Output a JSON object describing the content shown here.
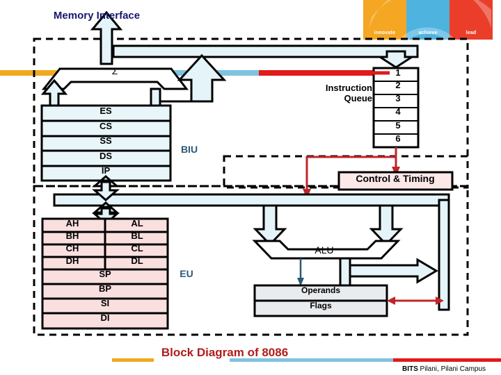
{
  "slide": {
    "memory_interface_label": "Memory Interface",
    "adder_symbol": "Σ",
    "biu_label": "BIU",
    "eu_label": "EU",
    "alu_label": "ALU",
    "instruction_queue_label_line1": "Instruction",
    "instruction_queue_label_line2": "Queue",
    "control_timing_label": "Control & Timing",
    "operands_label": "Operands",
    "flags_label": "Flags",
    "title": "Block Diagram of 8086"
  },
  "segment_registers": [
    {
      "name": "ES"
    },
    {
      "name": "CS"
    },
    {
      "name": "SS"
    },
    {
      "name": "DS"
    },
    {
      "name": "IP"
    }
  ],
  "instruction_queue_slots": [
    "1",
    "2",
    "3",
    "4",
    "5",
    "6"
  ],
  "general_registers": {
    "split_rows": [
      {
        "high": "AH",
        "low": "AL"
      },
      {
        "high": "BH",
        "low": "BL"
      },
      {
        "high": "CH",
        "low": "CL"
      },
      {
        "high": "DH",
        "low": "DL"
      }
    ],
    "full_rows": [
      {
        "name": "SP"
      },
      {
        "name": "BP"
      },
      {
        "name": "SI"
      },
      {
        "name": "DI"
      }
    ]
  },
  "logo": {
    "segments": [
      {
        "text": "innovate",
        "color": "#f5a623"
      },
      {
        "text": "achieve",
        "color": "#4fb3e0"
      },
      {
        "text": "lead",
        "color": "#ea3e2a"
      }
    ]
  },
  "footer": {
    "brand_bold": "BITS",
    "brand_rest": " Pilani, Pilani Campus"
  },
  "colors": {
    "bus_fill": "#e4f4f8",
    "segment_fill": "#e8f6fa",
    "register_fill": "#fadfdf",
    "control_fill": "#fde8e8",
    "operands_fill": "#e9ecef",
    "orange_rule": "#f0a91e",
    "blue_rule": "#7fc3e0",
    "red_rule": "#e01b18",
    "red_arrow": "#c0242a",
    "title_red": "#b01c1c",
    "label_blue": "#2d5775",
    "memory_label_navy": "#16166e",
    "outline": "#000000"
  }
}
